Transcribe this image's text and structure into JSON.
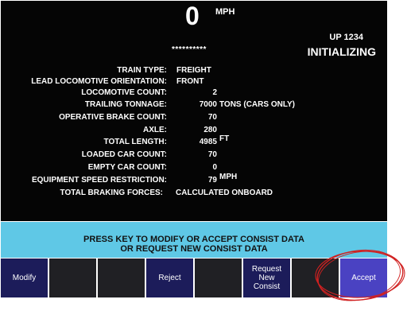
{
  "header": {
    "speed": "0",
    "speed_unit": "MPH",
    "masked": "**********",
    "train_id": "UP 1234",
    "status": "INITIALIZING"
  },
  "consist": [
    {
      "label": "TRAIN TYPE:",
      "value": "FREIGHT",
      "unit": ""
    },
    {
      "label": "LEAD LOCOMOTIVE ORIENTATION:",
      "value": "FRONT",
      "unit": ""
    },
    {
      "label": "LOCOMOTIVE COUNT:",
      "value": "2",
      "unit": ""
    },
    {
      "label": "TRAILING TONNAGE:",
      "value": "7000",
      "unit": "TONS (CARS ONLY)"
    },
    {
      "label": "OPERATIVE BRAKE COUNT:",
      "value": "70",
      "unit": ""
    },
    {
      "label": "AXLE:",
      "value": "280",
      "unit": ""
    },
    {
      "label": "TOTAL LENGTH:",
      "value": "4985",
      "unit": "FT"
    },
    {
      "label": "LOADED CAR COUNT:",
      "value": "70",
      "unit": ""
    },
    {
      "label": "EMPTY CAR COUNT:",
      "value": "0",
      "unit": ""
    },
    {
      "label": "EQUIPMENT SPEED RESTRICTION:",
      "value": "79",
      "unit": "MPH"
    },
    {
      "label": "TOTAL BRAKING FORCES:",
      "value": "CALCULATED ONBOARD",
      "unit": ""
    }
  ],
  "prompt": {
    "line1": "PRESS KEY TO MODIFY OR ACCEPT CONSIST DATA",
    "line2": "OR REQUEST NEW CONSIST DATA"
  },
  "softkeys": [
    {
      "label": "Modify"
    },
    {
      "label": ""
    },
    {
      "label": ""
    },
    {
      "label": "Reject"
    },
    {
      "label": ""
    },
    {
      "label": "Request\nNew\nConsist"
    },
    {
      "label": ""
    },
    {
      "label": "Accept"
    }
  ],
  "colors": {
    "screen_bg": "#050505",
    "prompt_bg": "#5fc8e6",
    "key_active": "#4a42c2",
    "key_blank": "#202024",
    "annotation": "#d02020"
  }
}
